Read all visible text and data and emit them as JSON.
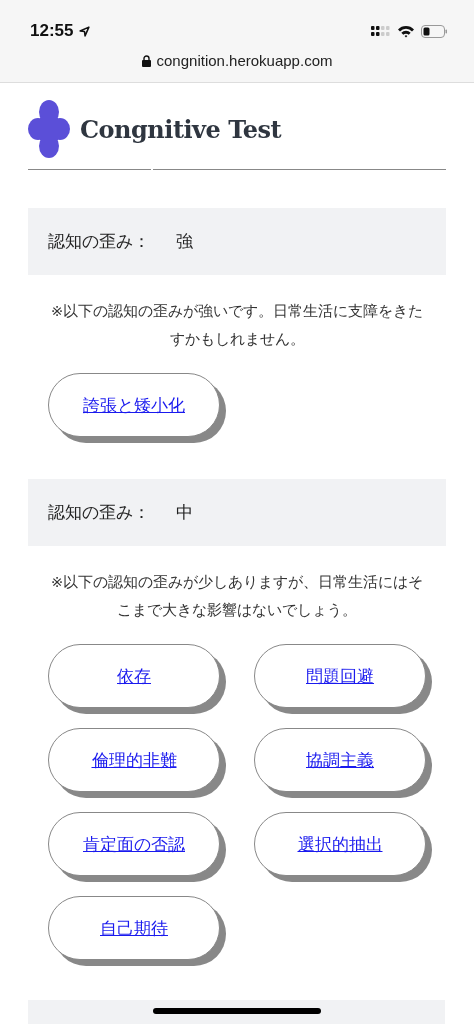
{
  "status_bar": {
    "time": "12:55"
  },
  "address_bar": {
    "url": "congnition.herokuapp.com"
  },
  "header": {
    "title": "Congnitive Test"
  },
  "sections": [
    {
      "label": "認知の歪み：",
      "level": "強",
      "description": "※以下の認知の歪みが強いです。日常生活に支障をきたすかもしれません。",
      "items": [
        "誇張と矮小化"
      ]
    },
    {
      "label": "認知の歪み：",
      "level": "中",
      "description": "※以下の認知の歪みが少しありますが、日常生活にはそこまで大きな影響はないでしょう。",
      "items": [
        "依存",
        "問題回避",
        "倫理的非難",
        "協調主義",
        "肯定面の否認",
        "選択的抽出",
        "自己期待"
      ]
    }
  ]
}
